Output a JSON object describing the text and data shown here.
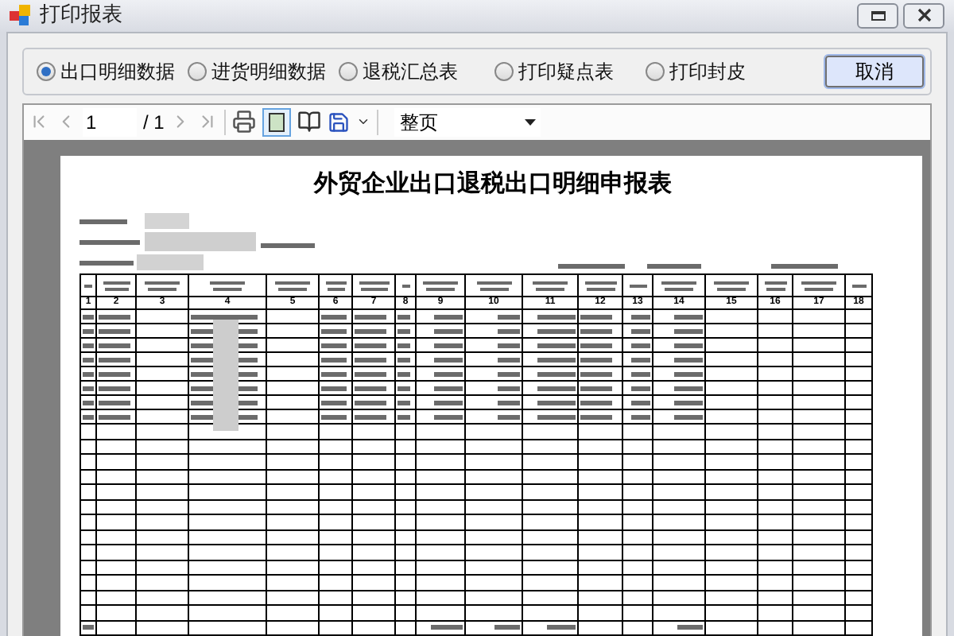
{
  "window": {
    "title": "打印报表"
  },
  "report_options": [
    {
      "label": "出口明细数据",
      "selected": true
    },
    {
      "label": "进货明细数据",
      "selected": false
    },
    {
      "label": "退税汇总表",
      "selected": false
    },
    {
      "label": "打印疑点表",
      "selected": false
    },
    {
      "label": "打印封皮",
      "selected": false
    }
  ],
  "cancel_button": "取消",
  "toolbar": {
    "page": "1",
    "page_total": "/ 1",
    "zoom": "整页"
  },
  "report": {
    "title": "外贸企业出口退税出口明细申报表",
    "column_numbers": [
      "1",
      "2",
      "3",
      "4",
      "5",
      "6",
      "7",
      "8",
      "9",
      "10",
      "11",
      "12",
      "13",
      "14",
      "15",
      "16",
      "17",
      "18"
    ]
  }
}
